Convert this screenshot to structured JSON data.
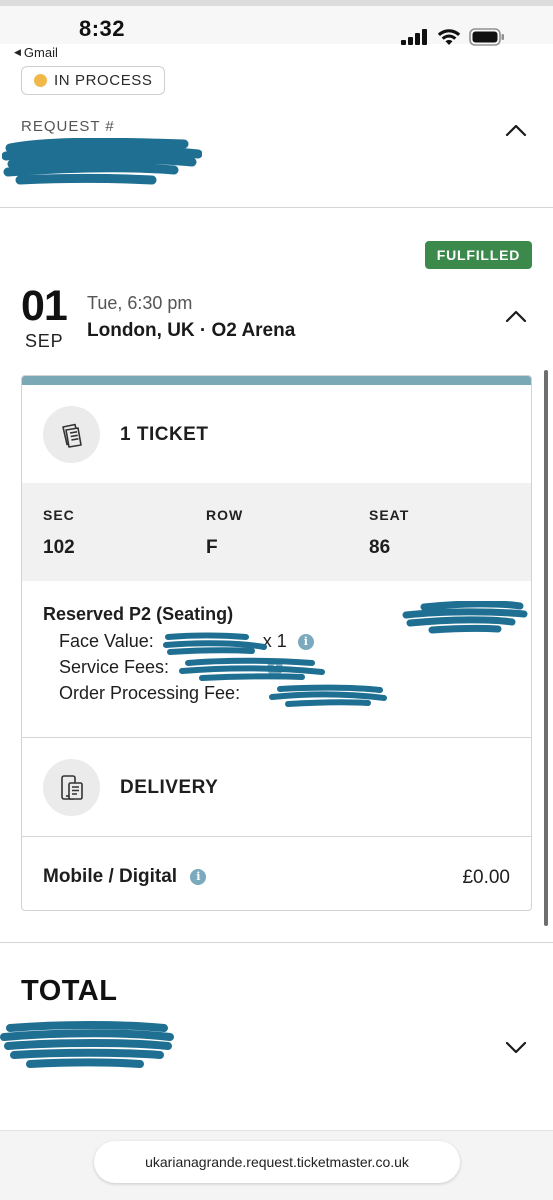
{
  "status_bar": {
    "time": "8:32",
    "back_app": "Gmail"
  },
  "request": {
    "status": "IN PROCESS",
    "status_color": "#f2b94a",
    "label": "REQUEST #"
  },
  "event": {
    "badge": "FULFILLED",
    "badge_color": "#3b8a4c",
    "day": "01",
    "month": "SEP",
    "time": "Tue, 6:30 pm",
    "venue": "London, UK · O2 Arena"
  },
  "tickets": {
    "title": "1 TICKET",
    "icon": "ticket-icon",
    "columns": [
      {
        "label": "SEC",
        "value": "102"
      },
      {
        "label": "ROW",
        "value": "F"
      },
      {
        "label": "SEAT",
        "value": "86"
      }
    ],
    "tier": "Reserved P2 (Seating)",
    "fees": {
      "face_value": "Face Value:",
      "face_value_qty": "x 1",
      "service_fees": "Service Fees:",
      "order_processing": "Order Processing Fee:"
    }
  },
  "delivery": {
    "title": "DELIVERY",
    "icon": "mobile-delivery-icon",
    "method": "Mobile / Digital",
    "price": "£0.00"
  },
  "total": {
    "label": "TOTAL"
  },
  "browser": {
    "url": "ukarianagrande.request.ticketmaster.co.uk"
  },
  "colors": {
    "accent_bar": "#7aa8b5",
    "redaction": "#1f6f92",
    "info_icon": "#7ba9bd"
  }
}
